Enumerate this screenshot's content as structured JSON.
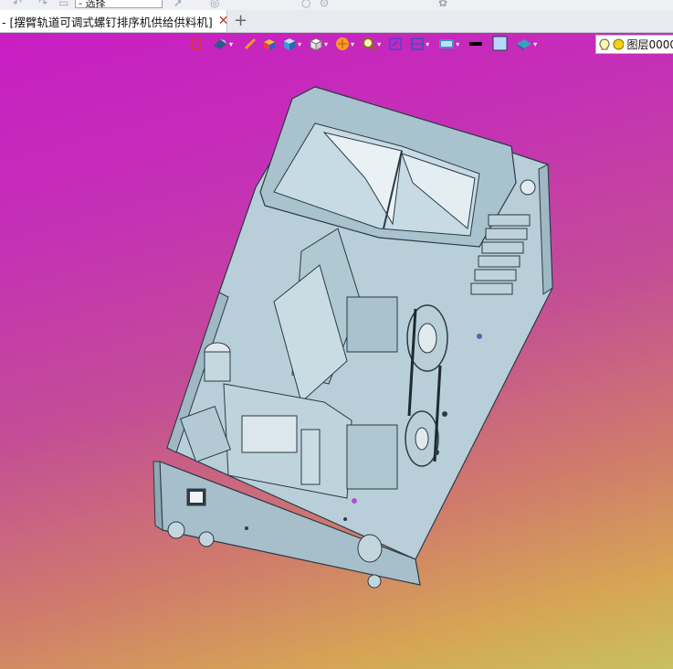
{
  "topbar": {
    "selection_value": "- 选择"
  },
  "tab": {
    "title": "- [摆臂轨道可调式螺钉排序机供给供料机]",
    "close_glyph": "✕",
    "add_glyph": "+"
  },
  "toolbar": {
    "icons": [
      "exit-sketch-icon",
      "view-orient-icon",
      "pencil-icon",
      "shaded-box-icon",
      "cube-blue-icon",
      "cube-white-icon",
      "render-sphere-icon",
      "zoom-lens-icon",
      "rotate-view-icon",
      "section-icon",
      "display-mode-icon",
      "line-color-icon",
      "face-color-icon",
      "layer-shape-icon"
    ]
  },
  "layer": {
    "label": "图层0000"
  },
  "colors": {
    "accent_top": "#c81ec4",
    "accent_bottom": "#c8c060",
    "model": "#b9d2dc"
  }
}
